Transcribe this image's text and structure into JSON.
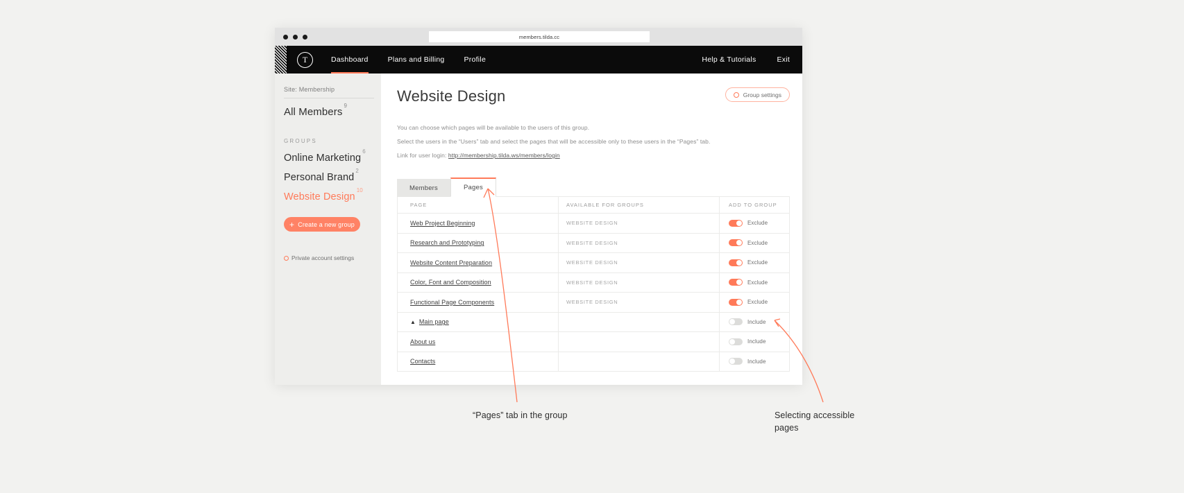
{
  "browser": {
    "url": "members.tilda.cc"
  },
  "topnav": {
    "logo": "T",
    "items": [
      {
        "label": "Dashboard",
        "active": true
      },
      {
        "label": "Plans and Billing",
        "active": false
      },
      {
        "label": "Profile",
        "active": false
      }
    ],
    "right": [
      {
        "label": "Help & Tutorials"
      },
      {
        "label": "Exit"
      }
    ]
  },
  "sidebar": {
    "site_label": "Site: Membership",
    "all_members": {
      "label": "All Members",
      "count": "9"
    },
    "groups_title": "GROUPS",
    "groups": [
      {
        "label": "Online Marketing",
        "count": "6",
        "active": false
      },
      {
        "label": "Personal Brand",
        "count": "2",
        "active": false
      },
      {
        "label": "Website Design",
        "count": "10",
        "active": true
      }
    ],
    "create_group_button": "Create a new group",
    "create_group_icon": "plus-icon",
    "private_settings": "Private account settings",
    "private_settings_icon": "gear-icon"
  },
  "main": {
    "title": "Website Design",
    "group_settings_button": "Group settings",
    "group_settings_icon": "gear-icon",
    "desc_line1": "You can choose which pages will be available to the users of this group.",
    "desc_line2": "Select the users in the “Users” tab and select the pages that will be accessible only to these users in the “Pages” tab.",
    "link_prefix": "Link for user login:",
    "link_url": "http://membership.tilda.ws/members/login",
    "tabs": [
      {
        "label": "Members",
        "active": false
      },
      {
        "label": "Pages",
        "active": true
      }
    ],
    "table": {
      "headers": [
        "PAGE",
        "AVAILABLE FOR GROUPS",
        "ADD TO GROUP"
      ],
      "rows": [
        {
          "page": "Web Project Beginning",
          "groups": "WEBSITE DESIGN",
          "toggle_state": "on",
          "toggle_label": "Exclude",
          "home": false
        },
        {
          "page": "Research and Prototyping",
          "groups": "WEBSITE DESIGN",
          "toggle_state": "on",
          "toggle_label": "Exclude",
          "home": false
        },
        {
          "page": "Website Content Preparation",
          "groups": "WEBSITE DESIGN",
          "toggle_state": "on",
          "toggle_label": "Exclude",
          "home": false
        },
        {
          "page": "Color, Font and Composition",
          "groups": "WEBSITE DESIGN",
          "toggle_state": "on",
          "toggle_label": "Exclude",
          "home": false
        },
        {
          "page": "Functional Page Components",
          "groups": "WEBSITE DESIGN",
          "toggle_state": "on",
          "toggle_label": "Exclude",
          "home": false
        },
        {
          "page": "Main page",
          "groups": "",
          "toggle_state": "off",
          "toggle_label": "Include",
          "home": true
        },
        {
          "page": "About us",
          "groups": "",
          "toggle_state": "off",
          "toggle_label": "Include",
          "home": false
        },
        {
          "page": "Contacts",
          "groups": "",
          "toggle_state": "off",
          "toggle_label": "Include",
          "home": false
        }
      ]
    }
  },
  "annotations": {
    "left": "“Pages” tab in the group",
    "right": "Selecting accessible pages"
  },
  "colors": {
    "accent": "#ff7a59",
    "nav_bg": "#0b0b0b",
    "sidebar_bg": "#eeeeec",
    "page_bg": "#f2f2f0"
  }
}
